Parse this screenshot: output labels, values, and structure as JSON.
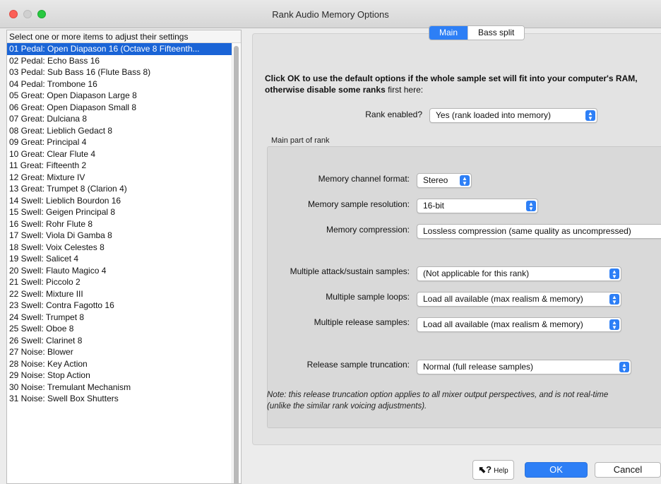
{
  "window": {
    "title": "Rank Audio Memory Options"
  },
  "list": {
    "header": "Select one or more items to adjust their settings",
    "items": [
      "01 Pedal: Open Diapason 16 (Octave 8 Fifteenth...",
      "02 Pedal: Echo Bass 16",
      "03 Pedal: Sub Bass 16 (Flute Bass 8)",
      "04 Pedal: Trombone 16",
      "05 Great: Open Diapason Large 8",
      "06 Great: Open Diapason Small 8",
      "07 Great: Dulciana 8",
      "08 Great: Lieblich Gedact 8",
      "09 Great: Principal 4",
      "10 Great: Clear Flute 4",
      "11 Great: Fifteenth 2",
      "12 Great: Mixture IV",
      "13 Great: Trumpet 8 (Clarion 4)",
      "14 Swell: Lieblich Bourdon 16",
      "15 Swell: Geigen Principal 8",
      "16 Swell: Rohr Flute 8",
      "17 Swell: Viola Di Gamba 8",
      "18 Swell: Voix Celestes 8",
      "19 Swell: Salicet 4",
      "20 Swell: Flauto Magico 4",
      "21 Swell: Piccolo 2",
      "22 Swell: Mixture III",
      "23 Swell: Contra Fagotto 16",
      "24 Swell: Trumpet 8",
      "25 Swell: Oboe 8",
      "26 Swell: Clarinet 8",
      "27 Noise: Blower",
      "28 Noise: Key Action",
      "29 Noise: Stop Action",
      "30 Noise: Tremulant Mechanism",
      "31 Noise: Swell Box Shutters"
    ]
  },
  "tabs": {
    "main": "Main",
    "bass_split": "Bass split"
  },
  "instructions": {
    "bold": "Click OK to use the default options if the whole sample set will fit into your computer's RAM,",
    "bold2": "otherwise disable some ranks",
    "normal": " first here:"
  },
  "rank_enabled": {
    "label": "Rank enabled?",
    "value": "Yes (rank loaded into memory)"
  },
  "group_label": "Main part of rank",
  "fields": {
    "channel_format": {
      "label": "Memory channel format:",
      "value": "Stereo"
    },
    "sample_resolution": {
      "label": "Memory sample resolution:",
      "value": "16-bit"
    },
    "compression": {
      "label": "Memory compression:",
      "value": "Lossless compression (same quality as uncompressed)"
    },
    "attack_sustain": {
      "label": "Multiple attack/sustain samples:",
      "value": "(Not applicable for this rank)"
    },
    "sample_loops": {
      "label": "Multiple sample loops:",
      "value": "Load all available (max realism & memory)"
    },
    "release_samples": {
      "label": "Multiple release samples:",
      "value": "Load all available (max realism & memory)"
    },
    "release_truncation": {
      "label": "Release sample truncation:",
      "value": "Normal (full release samples)"
    }
  },
  "note": {
    "line1": "Note: this release truncation option applies to all mixer output perspectives, and is not real-time",
    "line2": "(unlike the similar rank voicing adjustments)."
  },
  "buttons": {
    "help": "Help",
    "ok": "OK",
    "cancel": "Cancel"
  },
  "colors": {
    "accent": "#2d7ff6",
    "selection": "#1a64d6"
  }
}
